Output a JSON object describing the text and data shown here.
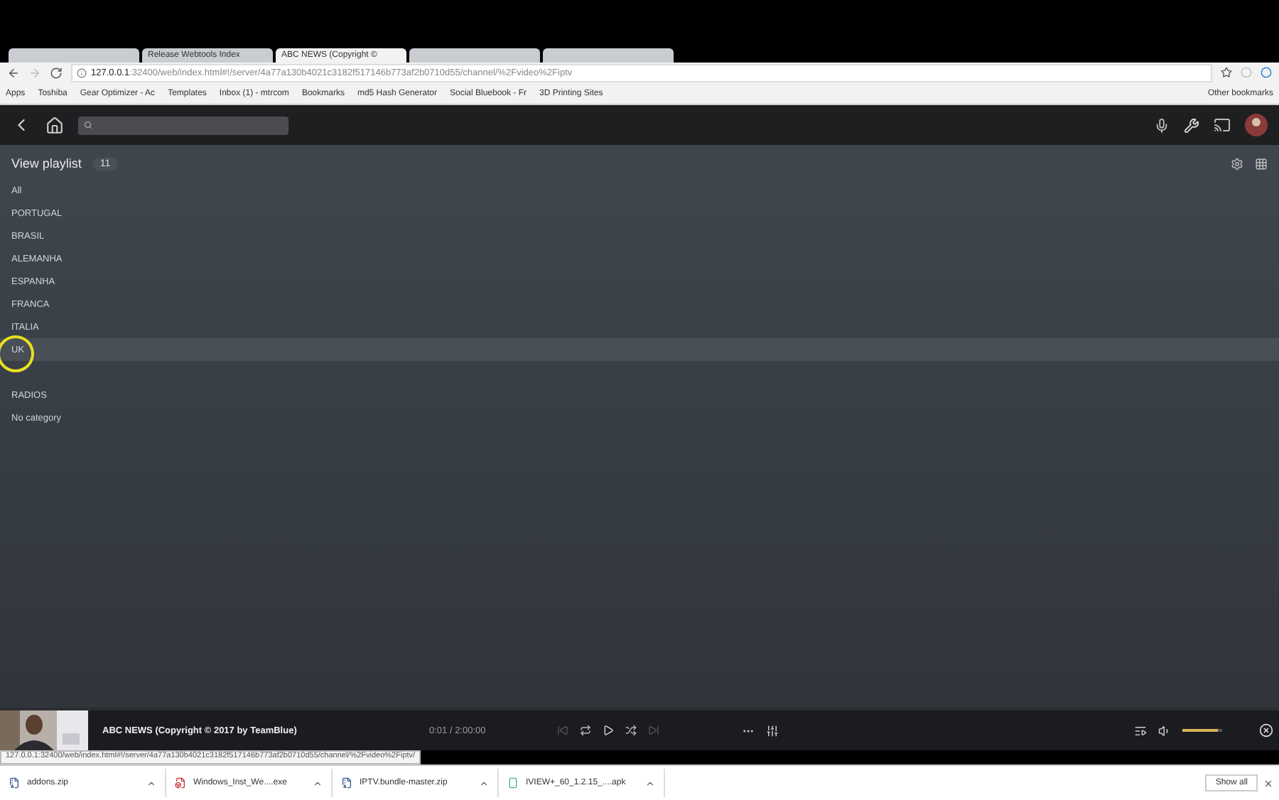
{
  "browser": {
    "tabs": [
      {
        "selected": false
      },
      {
        "title": "Release Webtools Index",
        "selected": false
      },
      {
        "title": "ABC NEWS (Copyright ©",
        "selected": true
      },
      {
        "selected": false
      },
      {
        "selected": false
      }
    ],
    "url_host": "127.0.0.1",
    "url_path": ":32400/web/index.html#!/server/4a77a130b4021c3182f517146b773af2b0710d55/channel/%2Fvideo%2Fiptv",
    "bookmarks": [
      "Apps",
      "Toshiba",
      "Gear Optimizer - Ac",
      "Templates",
      "Inbox (1) - mtrcom",
      "Bookmarks",
      "md5 Hash Generator",
      "Social Bluebook - Fr",
      "3D Printing Sites"
    ],
    "other_bookmarks": "Other bookmarks"
  },
  "playlist": {
    "title": "View playlist",
    "count": "11",
    "items": [
      {
        "label": "All",
        "hovered": false
      },
      {
        "label": "PORTUGAL",
        "hovered": false
      },
      {
        "label": "BRASIL",
        "hovered": false
      },
      {
        "label": "ALEMANHA",
        "hovered": false
      },
      {
        "label": "ESPANHA",
        "hovered": false
      },
      {
        "label": "FRANCA",
        "hovered": false
      },
      {
        "label": "ITALIA",
        "hovered": false
      },
      {
        "label": "UK",
        "hovered": true
      },
      {
        "hovered": false
      },
      {
        "label": "RADIOS",
        "hovered": false
      },
      {
        "label": "No category",
        "hovered": false
      }
    ]
  },
  "player": {
    "title": "ABC NEWS (Copyright © 2017 by TeamBlue)",
    "time": "0:01 / 2:00:00",
    "volume": {
      "level": 0.9
    }
  },
  "status_url": "127.0.0.1:32400/web/index.html#!/server/4a77a130b4021c3182f517146b773af2b0710d55/channel/%2Fvideo%2Fiptv/",
  "downloads": {
    "files": [
      {
        "name": "addons.zip",
        "kind": "zip"
      },
      {
        "name": "Windows_Inst_We....exe",
        "kind": "exe"
      },
      {
        "name": "IPTV.bundle-master.zip",
        "kind": "zip"
      },
      {
        "name": "IVIEW+_60_1.2.15_....apk",
        "kind": "apk"
      }
    ],
    "show_all": "Show all"
  }
}
